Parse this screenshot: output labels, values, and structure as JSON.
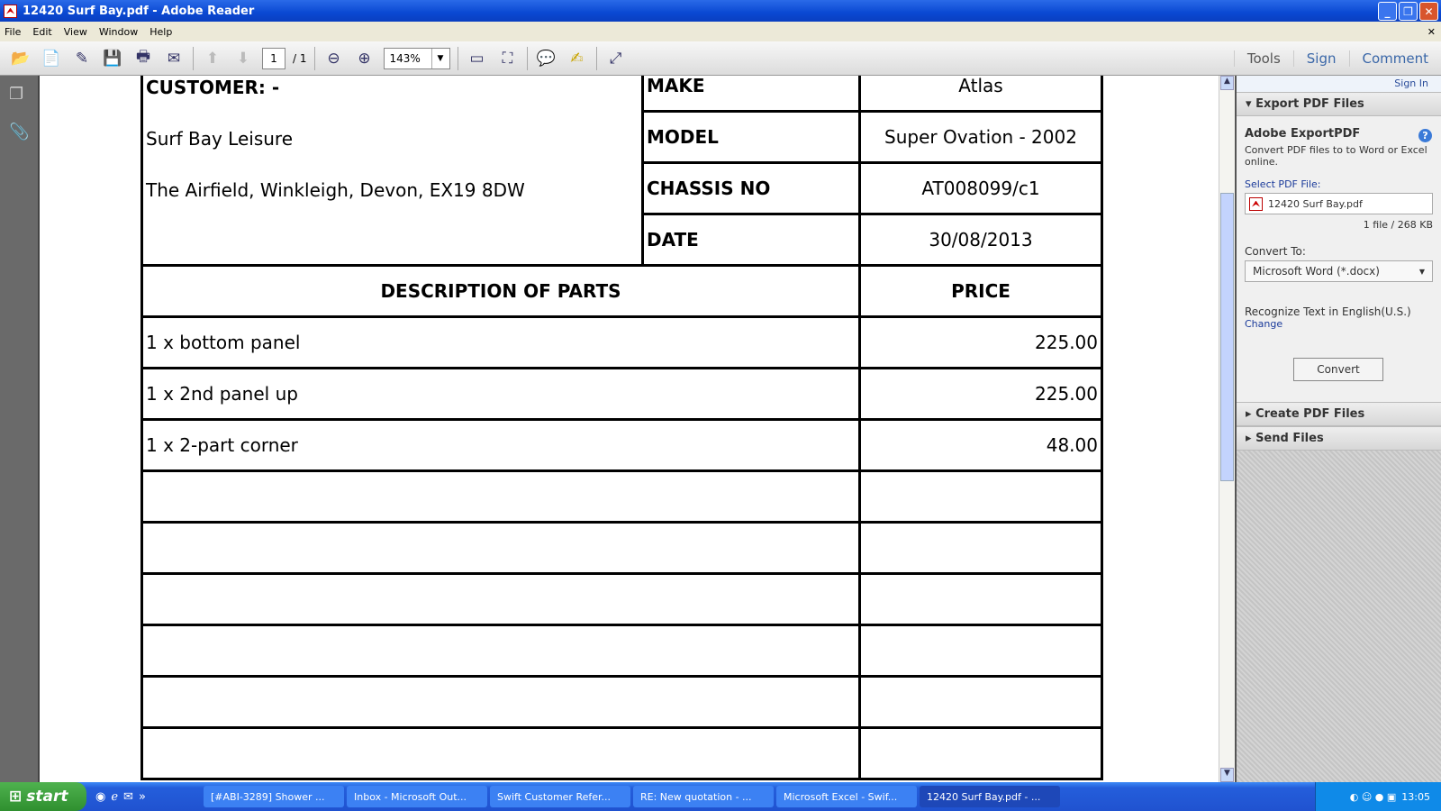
{
  "window": {
    "title": "12420 Surf Bay.pdf - Adobe Reader"
  },
  "menu": [
    "File",
    "Edit",
    "View",
    "Window",
    "Help"
  ],
  "toolbar": {
    "page_current": "1",
    "page_total": "/ 1",
    "zoom": "143%",
    "right": [
      "Tools",
      "Sign",
      "Comment"
    ]
  },
  "document": {
    "customer_label": "CUSTOMER: -",
    "customer_name": "Surf Bay Leisure",
    "customer_address": "The Airfield, Winkleigh, Devon, EX19 8DW",
    "fields": [
      {
        "label": "MAKE",
        "value": "Atlas"
      },
      {
        "label": "MODEL",
        "value": "Super Ovation - 2002"
      },
      {
        "label": "CHASSIS NO",
        "value": "AT008099/c1"
      },
      {
        "label": "DATE",
        "value": "30/08/2013"
      }
    ],
    "headers": {
      "description": "DESCRIPTION OF PARTS",
      "price": "PRICE"
    },
    "items": [
      {
        "description": "1 x bottom panel",
        "price": "225.00"
      },
      {
        "description": "1 x 2nd panel up",
        "price": "225.00"
      },
      {
        "description": "1 x 2-part corner",
        "price": "48.00"
      }
    ]
  },
  "panel": {
    "sign_in": "Sign In",
    "export_section": "Export PDF Files",
    "heading": "Adobe ExportPDF",
    "desc": "Convert PDF files to to Word or Excel online.",
    "select_label": "Select PDF File:",
    "file_name": "12420 Surf Bay.pdf",
    "file_size": "1 file / 268 KB",
    "convert_to_label": "Convert To:",
    "convert_to_value": "Microsoft Word (*.docx)",
    "recognize": "Recognize Text in English(U.S.)",
    "change": "Change",
    "convert_button": "Convert",
    "create_section": "Create PDF Files",
    "send_section": "Send Files"
  },
  "taskbar": {
    "start": "start",
    "tasks": [
      "[#ABI-3289] Shower ...",
      "Inbox - Microsoft Out...",
      "Swift Customer Refer...",
      "RE: New quotation - ...",
      "Microsoft Excel - Swif...",
      "12420 Surf Bay.pdf - ..."
    ],
    "clock": "13:05"
  }
}
